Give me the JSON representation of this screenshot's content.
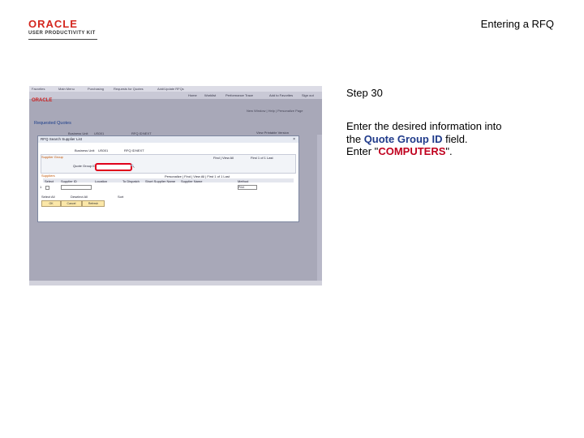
{
  "header": {
    "logo_word": "ORACLE",
    "logo_sub": "USER PRODUCTIVITY KIT",
    "title": "Entering a RFQ"
  },
  "screenshot": {
    "topbar": [
      "Favorites",
      "Main Menu",
      "Purchasing",
      "Requests for Quotes",
      "Add/Update RFQs"
    ],
    "nav": [
      "Home",
      "Worklist",
      "Performance Trace",
      "Add to Favorites",
      "Sign out"
    ],
    "brand": "ORACLE",
    "breadcrumb": "New Window | Help | Personalize Page",
    "section_title": "Requested Quotes",
    "business_unit_label": "Business Unit",
    "business_unit": "US001",
    "rfq_id_label": "RFQ ID",
    "rfq_id": "NEXT",
    "view_printable": "View Printable Version",
    "modal": {
      "title": "RFQ Search Supplier List",
      "close": "×",
      "bu_label": "Business Unit",
      "bu": "US001",
      "rfq_label": "RFQ ID",
      "rfq": "NEXT",
      "group_label": "Supplier Group",
      "find_links": "Find | View All",
      "nav_text": "First  1 of 1  Last",
      "quote_group_label": "Quote Group ID",
      "quote_group_value": "",
      "suppliers_label": "Suppliers",
      "supplier_nav": "Personalize | Find | View All | First  1 of 1  Last",
      "col_select": "Select",
      "col_supplier": "Supplier ID",
      "col_location": "Location",
      "col_to_dispatch": "To Dispatch",
      "col_name": "Short Supplier Name",
      "col_supplier_name": "Supplier Name",
      "col_method": "Method",
      "method_value": "Print",
      "row_count": "1",
      "select_all": "Select All",
      "deselect_all": "Deselect All",
      "sort_label": "Sort",
      "ok_btn": "OK",
      "cancel_btn": "Cancel",
      "refresh_btn": "Refresh"
    }
  },
  "step": {
    "label": "Step 30",
    "line1": "Enter the desired information into",
    "line2_pre": "the ",
    "line2_field": "Quote Group ID",
    "line2_post": " field.",
    "line3_pre": "Enter \"",
    "line3_value": "COMPUTERS",
    "line3_post": "\"."
  }
}
